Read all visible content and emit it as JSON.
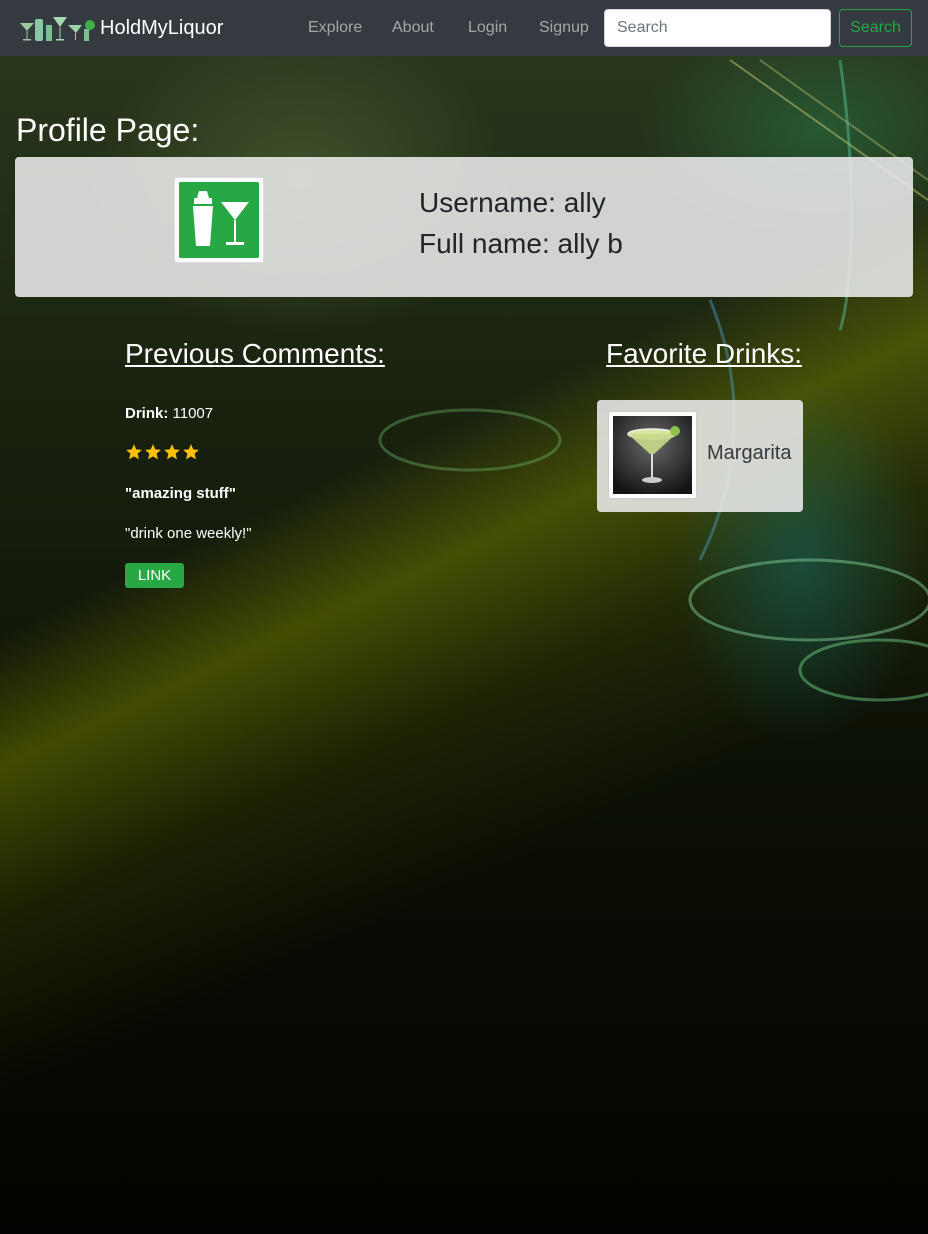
{
  "navbar": {
    "brand": "HoldMyLiquor",
    "links": [
      "Explore",
      "About",
      "Login",
      "Signup"
    ],
    "search_placeholder": "Search",
    "search_button": "Search",
    "search_button_color": "#28a745",
    "background_color": "#343a40"
  },
  "profile": {
    "page_title": "Profile Page:",
    "username_line": "Username: ally",
    "fullname_line": "Full name: ally b",
    "avatar_icon": "cocktail-shaker-glass-icon"
  },
  "comments": {
    "heading": "Previous Comments:",
    "items": [
      {
        "drink_label": "Drink:",
        "drink_id": "11007",
        "rating": 4,
        "rating_max": 4,
        "title": "\"amazing stuff\"",
        "text": "\"drink one weekly!\"",
        "link_label": "LINK"
      }
    ]
  },
  "favorites": {
    "heading": "Favorite Drinks:",
    "items": [
      {
        "name": "Margarita",
        "icon": "margarita-glass-icon"
      }
    ]
  },
  "colors": {
    "accent": "#28a745",
    "star": "#ffc107"
  }
}
